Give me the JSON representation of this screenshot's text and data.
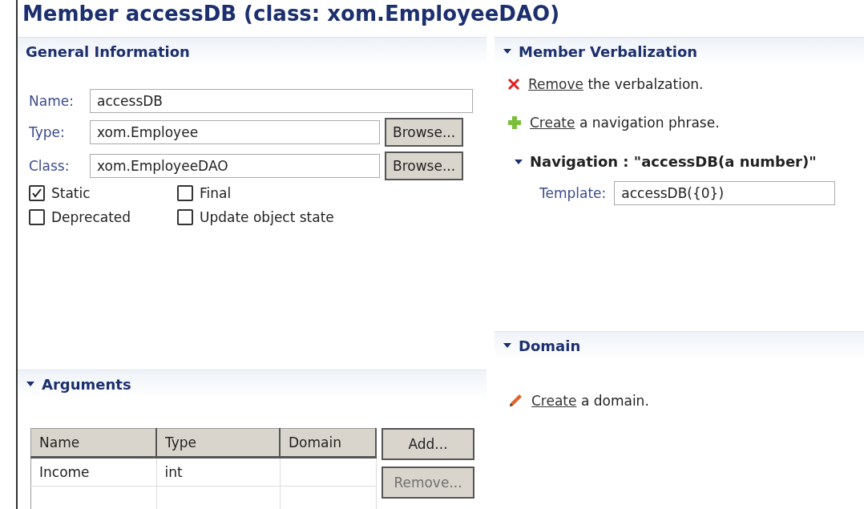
{
  "title": "Member accessDB (class: xom.EmployeeDAO)",
  "general": {
    "heading": "General Information",
    "fields": [
      {
        "label": "Name:",
        "value": "accessDB"
      },
      {
        "label": "Type:",
        "value": "xom.Employee",
        "button": "Browse..."
      },
      {
        "label": "Class:",
        "value": "xom.EmployeeDAO",
        "button": "Browse..."
      }
    ],
    "checkboxes": [
      {
        "label": "Static",
        "checked": true
      },
      {
        "label": "Final",
        "checked": false
      },
      {
        "label": "Deprecated",
        "checked": false
      },
      {
        "label": "Update object state",
        "checked": false
      }
    ]
  },
  "verbalization": {
    "heading": "Member Verbalization",
    "expanded": true,
    "actions": [
      {
        "kind": "remove",
        "link": "Remove",
        "rest": " the verbalzation."
      },
      {
        "kind": "add",
        "link": "Create",
        "rest": " a navigation phrase."
      }
    ],
    "navigation": {
      "heading": "Navigation : \"accessDB(a number)\"",
      "expanded": true,
      "template_label": "Template:",
      "template": "accessDB({0})"
    }
  },
  "arguments": {
    "heading": "Arguments",
    "expanded": true,
    "columns": [
      "Name",
      "Type",
      "Domain"
    ],
    "rows": [
      [
        "Income",
        "int",
        ""
      ]
    ],
    "buttons": [
      {
        "label": "Add...",
        "disabled": false
      },
      {
        "label": "Remove...",
        "disabled": true
      }
    ]
  },
  "domain": {
    "heading": "Domain",
    "expanded": true,
    "actions": [
      {
        "kind": "edit",
        "link": "Create",
        "rest": " a domain."
      }
    ]
  }
}
